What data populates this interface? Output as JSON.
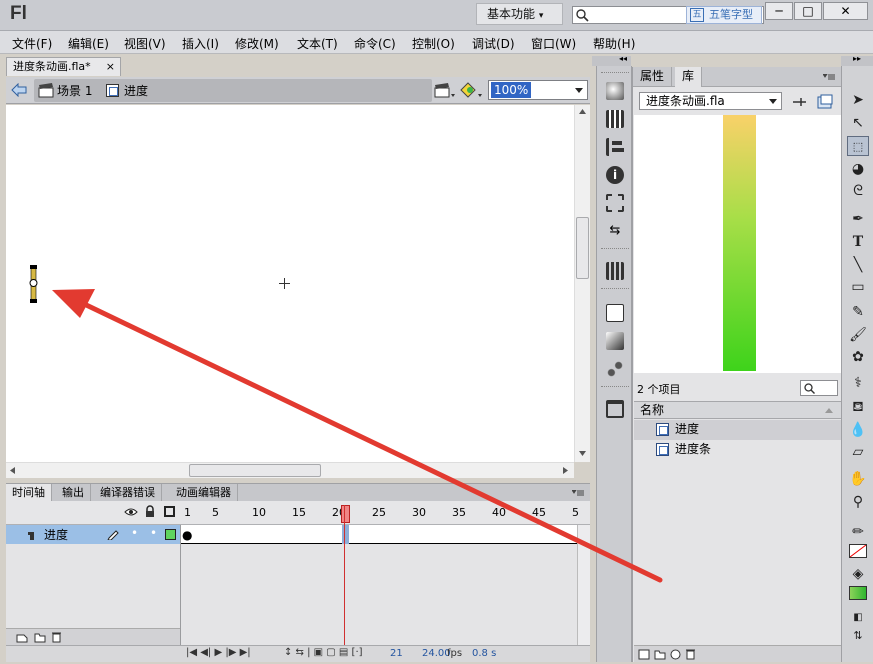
{
  "app": {
    "logo": "Fl",
    "workspace": "基本功能",
    "workspace_arrow": "▾",
    "ime": "五笔字型"
  },
  "window_controls": {
    "minimize": "─",
    "maximize": "□",
    "close": "✕"
  },
  "menu": [
    "文件(F)",
    "编辑(E)",
    "视图(V)",
    "插入(I)",
    "修改(M)",
    "文本(T)",
    "命令(C)",
    "控制(O)",
    "调试(D)",
    "窗口(W)",
    "帮助(H)"
  ],
  "doc": {
    "tab": "进度条动画.fla*",
    "close": "×",
    "scene": "场景 1",
    "symbol": "进度",
    "zoom": "100%"
  },
  "timeline": {
    "tabs": [
      "时间轴",
      "输出",
      "编译器错误",
      "动画编辑器"
    ],
    "frame_numbers": [
      "1",
      "5",
      "10",
      "15",
      "20",
      "25",
      "30",
      "35",
      "40",
      "45",
      "5"
    ],
    "layer": "进度",
    "current_frame": "21",
    "fps": "24.00",
    "fps_unit": "fps",
    "time": "0.8 s"
  },
  "library": {
    "tabs": [
      "属性",
      "库"
    ],
    "file": "进度条动画.fla",
    "count": "2 个项目",
    "column": "名称",
    "items": [
      "进度",
      "进度条"
    ]
  },
  "colors": {
    "progress_top": "#f9d169",
    "progress_bottom": "#3ed31b",
    "arrow": "#e23a30",
    "playhead": "#e0504a",
    "layer_selected": "#9bbfe6"
  },
  "icons": {
    "tools": [
      "selection-icon",
      "subselection-icon",
      "free-transform-icon",
      "3d-rotation-icon",
      "lasso-icon",
      "pen-icon",
      "text-icon",
      "line-icon",
      "rectangle-icon",
      "pencil-icon",
      "brush-icon",
      "deco-icon",
      "bone-icon",
      "paint-bucket-icon",
      "eyedropper-icon",
      "eraser-icon",
      "hand-icon",
      "zoom-icon",
      "stroke-color-icon",
      "fill-color-icon",
      "swap-colors-icon"
    ]
  }
}
